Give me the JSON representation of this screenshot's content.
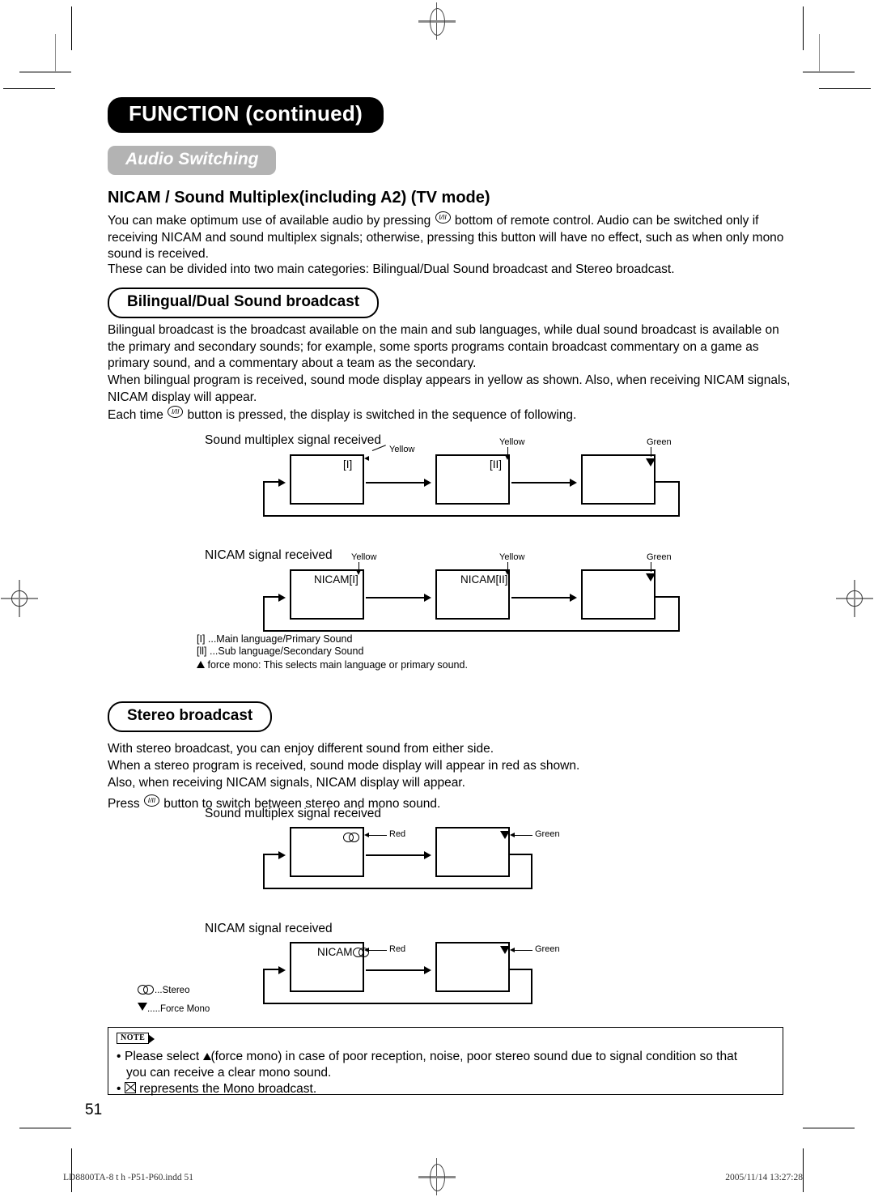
{
  "header": {
    "title": "FUNCTION (continued)",
    "subtitle": "Audio Switching"
  },
  "section_nicam": {
    "heading": "NICAM / Sound Multiplex(including A2)   (TV mode)",
    "para1_a": "You can make optimum use of available audio by pressing ",
    "para1_b": " bottom of remote control.  Audio can be switched only if receiving NICAM and sound multiplex signals;   otherwise, pressing this button will have no effect, such as when only mono sound is received.",
    "para2": "These can be divided into two main categories: Bilingual/Dual Sound broadcast and Stereo broadcast."
  },
  "bilingual": {
    "pill_label": "Bilingual/Dual Sound broadcast",
    "para1": "Bilingual broadcast is the broadcast available on the main and sub languages, while dual sound broadcast is available on the primary and secondary sounds;   for example, some sports programs contain broadcast commentary on a game as primary sound, and a commentary about a team as the secondary.",
    "para2": "When bilingual program is received, sound mode display appears in yellow as shown. Also, when receiving NICAM signals, NICAM display will appear.",
    "para3_a": "Each time ",
    "para3_b": " button is pressed, the display is switched in the sequence of following.",
    "diagram1": {
      "caption": "Sound multiplex signal received",
      "box1_label": "[I]",
      "box1_callout": "Yellow",
      "box2_label": "[II]",
      "box2_callout": "Yellow",
      "box3_label": "force-mono-triangle",
      "box3_callout": "Green"
    },
    "diagram2": {
      "caption": "NICAM signal received",
      "box1_label": "NICAM[I]",
      "box1_callout": "Yellow",
      "box2_label": "NICAM[II]",
      "box2_callout": "Yellow",
      "box3_label": "force-mono-triangle",
      "box3_callout": "Green"
    },
    "legend": {
      "line1": "[I]  ...Main language/Primary Sound",
      "line2": "[ll]  ...Sub language/Secondary Sound",
      "line3": " force mono: This selects main language or primary sound."
    }
  },
  "stereo": {
    "pill_label": "Stereo broadcast",
    "para1": "With stereo broadcast, you can enjoy different sound from either side.",
    "para2": "When a stereo program is received, sound mode display will appear in red as shown.",
    "para3": "Also, when receiving NICAM signals, NICAM display will appear.",
    "para4_a": "Press ",
    "para4_b": " button to switch between stereo and mono sound.",
    "diagram1": {
      "caption": "Sound multiplex signal received",
      "box1_label": "stereo-glyph",
      "box1_callout": "Red",
      "box2_label": "force-mono-triangle",
      "box2_callout": "Green"
    },
    "diagram2": {
      "caption": "NICAM signal received",
      "box1_label": "NICAM",
      "box1_callout": "Red",
      "box2_label": "force-mono-triangle",
      "box2_callout": "Green"
    },
    "legend": {
      "line1": "...Stereo",
      "line2": ".....Force Mono"
    }
  },
  "note": {
    "tag": "NOTE",
    "line1_a": "Please select ",
    "line1_b": "(force mono) in case of poor reception, noise, poor stereo sound due to signal condition so that",
    "line2": "you can receive a clear mono sound.",
    "line3": " represents the Mono broadcast."
  },
  "footer": {
    "page_number": "51",
    "file_name": "LD8800TA-8 t  h -P51-P60.indd   51",
    "timestamp": "2005/11/14   13:27:28"
  },
  "button_glyph": "I/II"
}
